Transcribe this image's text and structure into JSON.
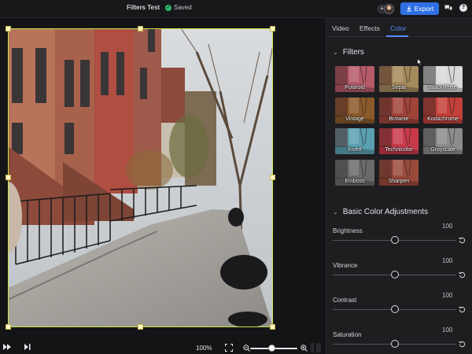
{
  "app": {
    "document_title": "Filters Test",
    "saved_status": "Saved",
    "export_label": "Export"
  },
  "icons": {
    "saved": "check-circle-icon",
    "export": "download-icon",
    "chat": "chat-bubbles-icon",
    "help": "help-icon",
    "add_collaborator": "plus-icon",
    "play": "play-forward-icon",
    "skip": "skip-end-icon",
    "fit": "fit-screen-icon",
    "zoom_out": "zoom-out-icon",
    "zoom_in": "zoom-in-icon",
    "reset": "reset-icon"
  },
  "help_glyph": "?",
  "add_glyph": "+",
  "tabs": [
    {
      "label": "Video",
      "active": false
    },
    {
      "label": "Effects",
      "active": false
    },
    {
      "label": "Color",
      "active": true
    }
  ],
  "filters_section": {
    "title": "Filters",
    "items": [
      {
        "label": "Polaroid",
        "tint": "#b65a6a"
      },
      {
        "label": "Sepia",
        "tint": "#a58a5c"
      },
      {
        "label": "BlackWhite",
        "tint": "#d9d9d9"
      },
      {
        "label": "Vintage",
        "tint": "#8a5a2a"
      },
      {
        "label": "Brownie",
        "tint": "#a0443a"
      },
      {
        "label": "Kodachrome",
        "tint": "#c4403a"
      },
      {
        "label": "Invert",
        "tint": "#5aa0b0"
      },
      {
        "label": "Technicolor",
        "tint": "#c83a4a"
      },
      {
        "label": "Grayscale",
        "tint": "#8c8c8c"
      },
      {
        "label": "Emboss",
        "tint": "#6a6a6a"
      },
      {
        "label": "Sharpen",
        "tint": "#9a4a3a"
      }
    ]
  },
  "adjustments_section": {
    "title": "Basic Color Adjustments",
    "items": [
      {
        "label": "Brightness",
        "value": "100",
        "level": 0.5
      },
      {
        "label": "Vibrance",
        "value": "100",
        "level": 0.5
      },
      {
        "label": "Contrast",
        "value": "100",
        "level": 0.5
      },
      {
        "label": "Saturation",
        "value": "100",
        "level": 0.5
      }
    ]
  },
  "playback": {
    "zoom": "100%",
    "zoom_level": 0.45
  },
  "colors": {
    "accent": "#5a8cff",
    "export_bg": "#2f6fe4",
    "selection": "#c8e64a",
    "saved_green": "#2fb86b"
  }
}
